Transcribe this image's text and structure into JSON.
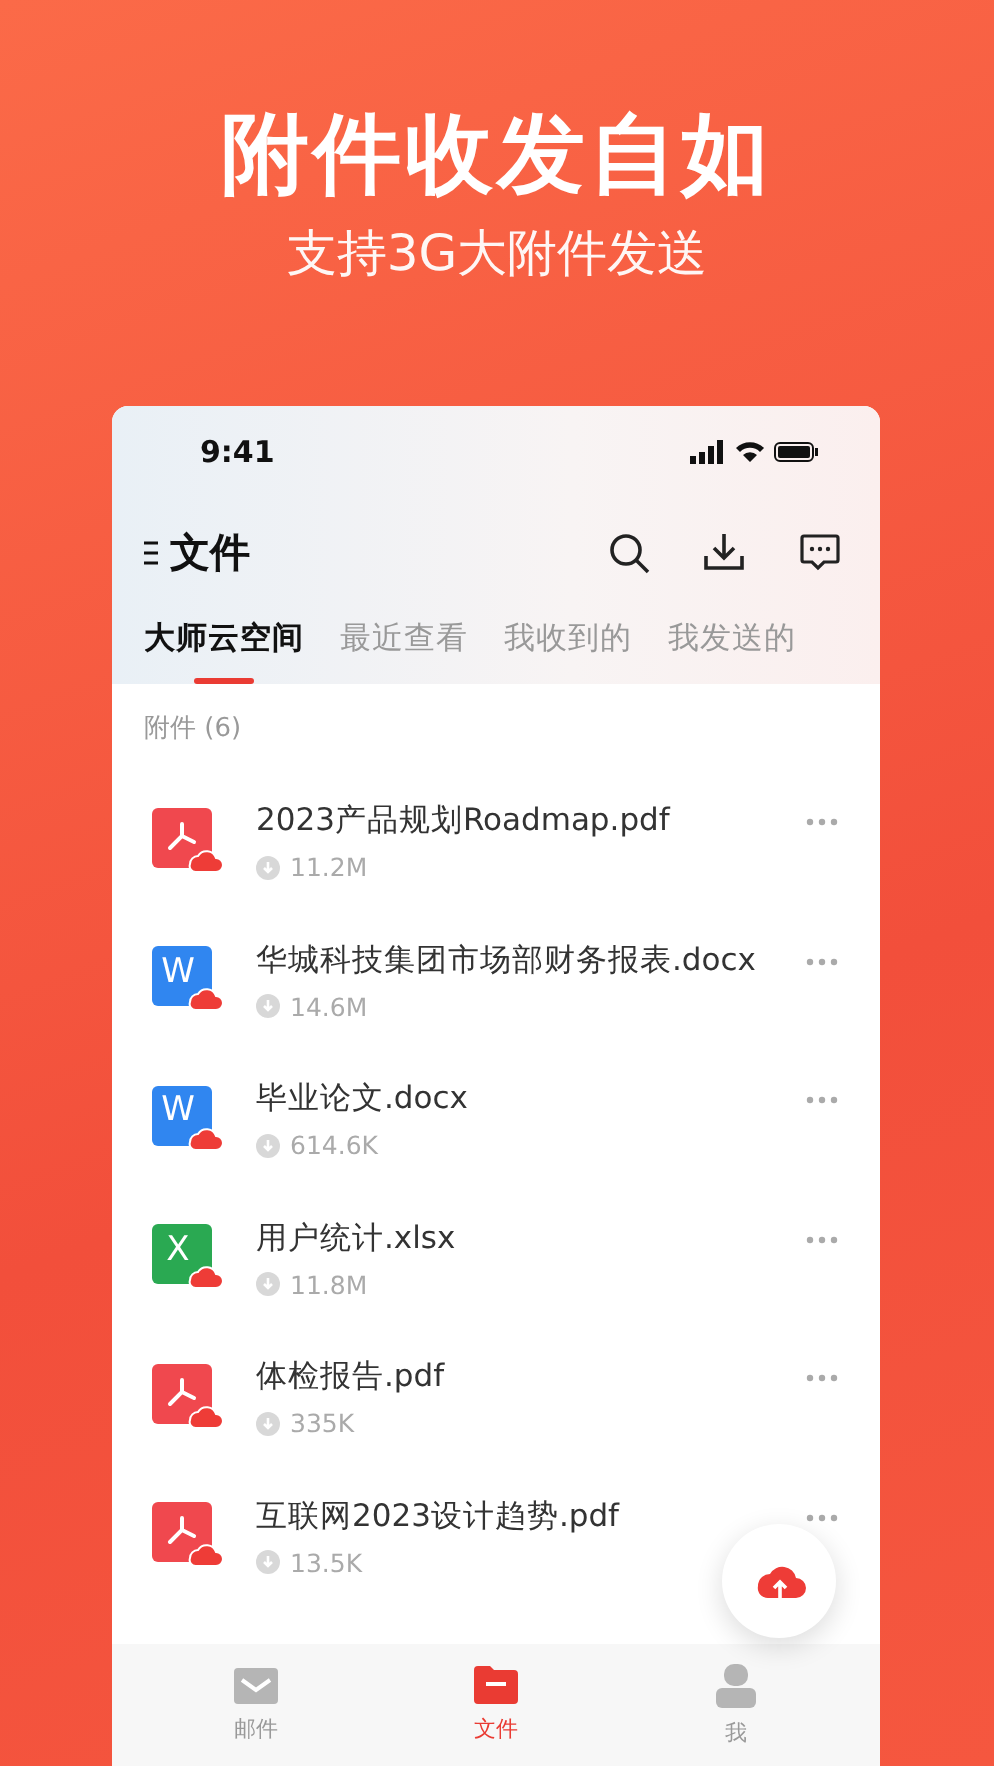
{
  "promo": {
    "headline": "附件收发自如",
    "subline": "支持3G大附件发送"
  },
  "status_bar": {
    "time": "9:41"
  },
  "header": {
    "title": "文件"
  },
  "tabs": [
    {
      "label": "大师云空间",
      "selected": true
    },
    {
      "label": "最近查看",
      "selected": false
    },
    {
      "label": "我收到的",
      "selected": false
    },
    {
      "label": "我发送的",
      "selected": false
    }
  ],
  "section": {
    "label": "附件 (6)"
  },
  "files": [
    {
      "name": "2023产品规划Roadmap.pdf",
      "size": "11.2M",
      "kind": "pdf"
    },
    {
      "name": "华城科技集团市场部财务报表.docx",
      "size": "14.6M",
      "kind": "word",
      "icon_letter": "W"
    },
    {
      "name": "毕业论文.docx",
      "size": "614.6K",
      "kind": "word",
      "icon_letter": "W"
    },
    {
      "name": "用户统计.xlsx",
      "size": "11.8M",
      "kind": "excel",
      "icon_letter": "X"
    },
    {
      "name": "体检报告.pdf",
      "size": "335K",
      "kind": "pdf"
    },
    {
      "name": "互联网2023设计趋势.pdf",
      "size": "13.5K",
      "kind": "pdf"
    }
  ],
  "nav": [
    {
      "label": "邮件",
      "kind": "mail",
      "selected": false
    },
    {
      "label": "文件",
      "kind": "folder",
      "selected": true
    },
    {
      "label": "我",
      "kind": "person",
      "selected": false
    }
  ]
}
